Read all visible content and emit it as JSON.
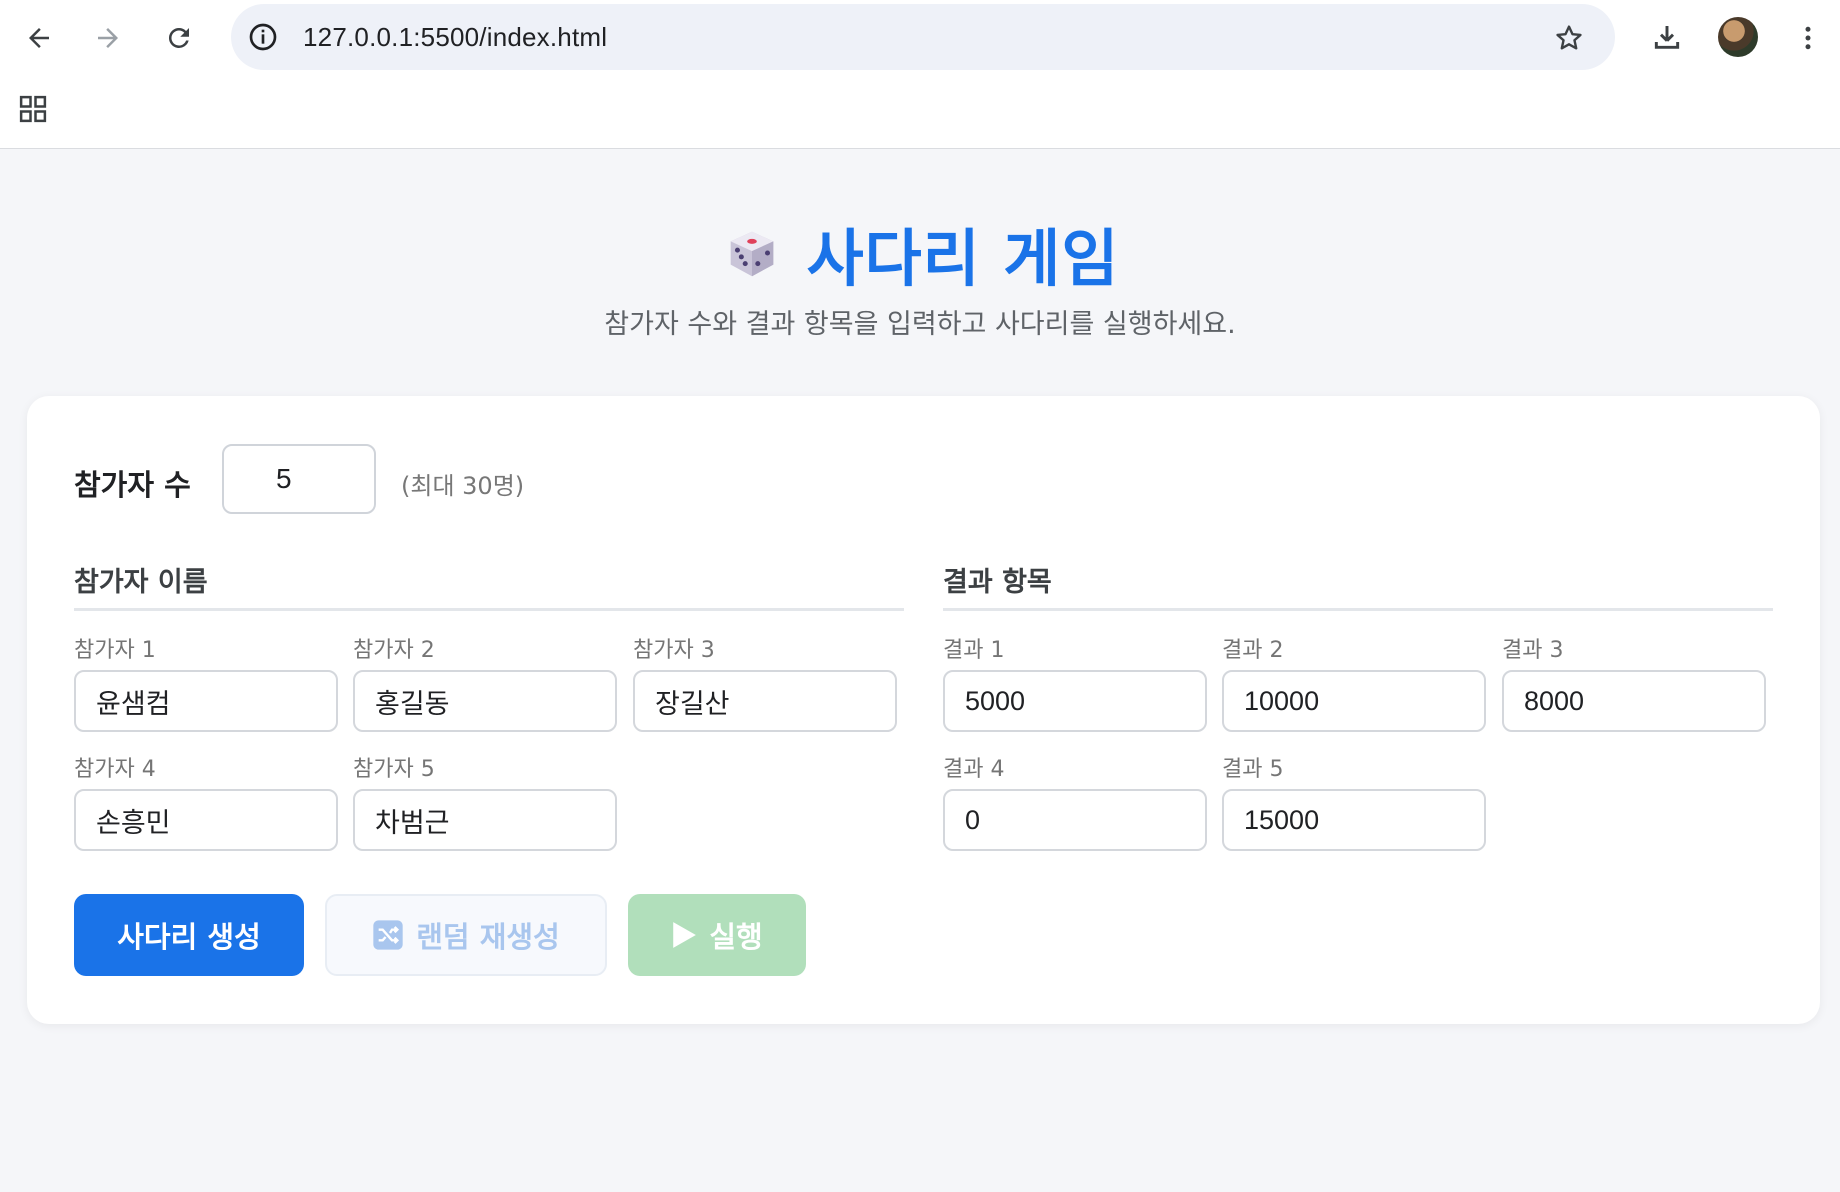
{
  "browser": {
    "url": "127.0.0.1:5500/index.html"
  },
  "header": {
    "title": "사다리 게임",
    "subtitle": "참가자 수와 결과 항목을 입력하고 사다리를 실행하세요."
  },
  "settings": {
    "count_label": "참가자 수",
    "count_value": "5",
    "count_hint": "(최대 30명)"
  },
  "participants": {
    "section_title": "참가자 이름",
    "fields": [
      {
        "label": "참가자 1",
        "value": "윤샘컴"
      },
      {
        "label": "참가자 2",
        "value": "홍길동"
      },
      {
        "label": "참가자 3",
        "value": "장길산"
      },
      {
        "label": "참가자 4",
        "value": "손흥민"
      },
      {
        "label": "참가자 5",
        "value": "차범근"
      }
    ]
  },
  "results": {
    "section_title": "결과 항목",
    "fields": [
      {
        "label": "결과 1",
        "value": "5000"
      },
      {
        "label": "결과 2",
        "value": "10000"
      },
      {
        "label": "결과 3",
        "value": "8000"
      },
      {
        "label": "결과 4",
        "value": "0"
      },
      {
        "label": "결과 5",
        "value": "15000"
      }
    ]
  },
  "actions": {
    "generate_label": "사다리 생성",
    "shuffle_label": "랜덤 재생성",
    "shuffle_icon": "shuffle-icon",
    "run_label": "실행",
    "run_icon": "play-icon"
  },
  "colors": {
    "accent": "#1a73e8",
    "run_disabled": "#b1dfbb",
    "page_bg": "#f5f6f9"
  }
}
